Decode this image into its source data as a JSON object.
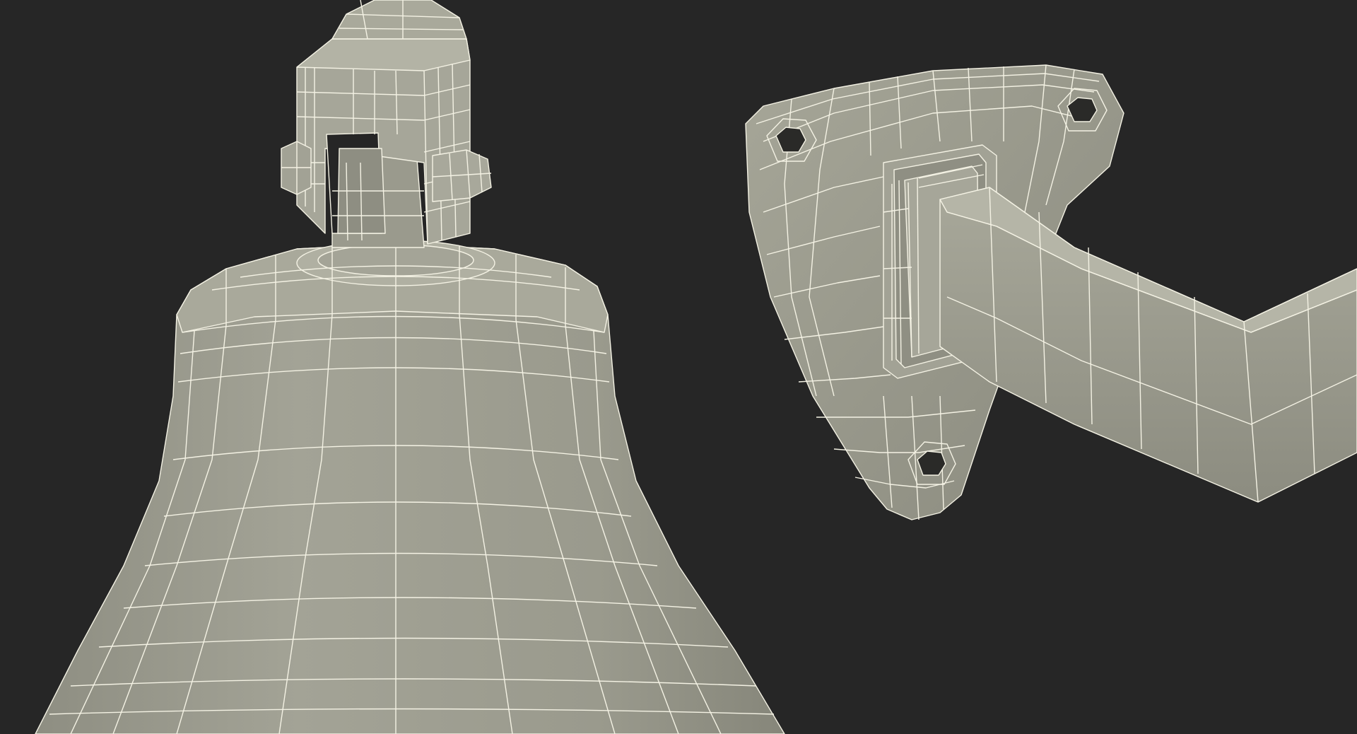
{
  "scene": {
    "objects": [
      "bell",
      "wall-bracket"
    ],
    "colors": {
      "background": "#262626",
      "mesh_fill": "#9c9c8e",
      "mesh_fill_dark": "#7e7e72",
      "mesh_fill_light": "#b4b4a6",
      "wireframe": "#f4f2e4",
      "hole": "#2a2a28"
    }
  }
}
